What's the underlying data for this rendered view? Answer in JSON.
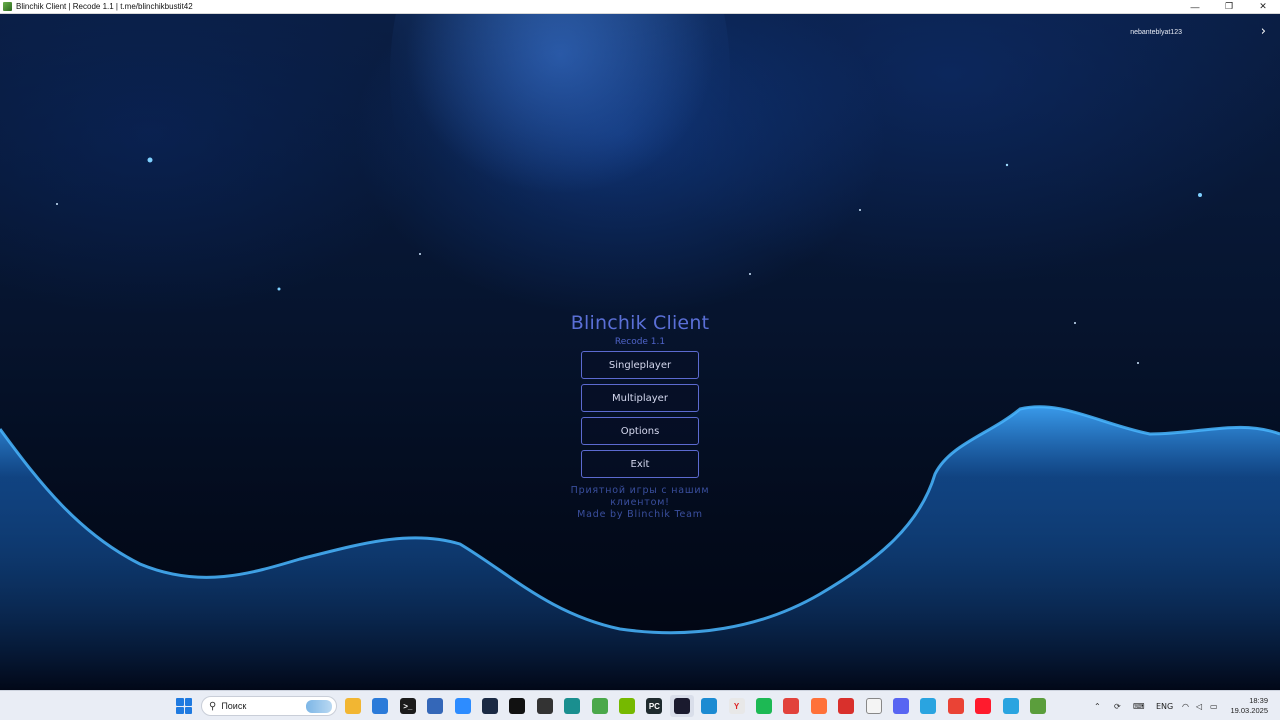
{
  "window": {
    "title": "Blinchik Client | Recode 1.1 | t.me/blinchikbustit42",
    "minimize": "—",
    "maximize": "❐",
    "close": "✕"
  },
  "profile": {
    "username": "nebanteblyat123",
    "arrow": "›"
  },
  "menu": {
    "title": "Blinchik Client",
    "subtitle": "Recode 1.1",
    "buttons": [
      "Singleplayer",
      "Multiplayer",
      "Options",
      "Exit"
    ],
    "note_line1": "Приятной игры с нашим клиентом!",
    "note_line2": "Made by Blinchik Team"
  },
  "colors": {
    "accent": "#5a6fd6",
    "button_border": "#5c6ad0",
    "note": "#3a4f9e"
  },
  "taskbar": {
    "search_icon": "search-icon",
    "search_placeholder": "Поиск",
    "apps": [
      {
        "name": "file-explorer-icon",
        "color": "#f2b632",
        "glyph": ""
      },
      {
        "name": "store-icon",
        "color": "#2b7bd9",
        "glyph": ""
      },
      {
        "name": "terminal-icon",
        "color": "#1b1b1b",
        "glyph": ">_"
      },
      {
        "name": "notepad-icon",
        "color": "#3467b8",
        "glyph": ""
      },
      {
        "name": "zoom-icon",
        "color": "#2d8cff",
        "glyph": ""
      },
      {
        "name": "steam-icon",
        "color": "#1b2a44",
        "glyph": ""
      },
      {
        "name": "capcut-icon",
        "color": "#111111",
        "glyph": ""
      },
      {
        "name": "nvidia-broadcast-icon",
        "color": "#333333",
        "glyph": ""
      },
      {
        "name": "media-app-icon",
        "color": "#1a8f8f",
        "glyph": ""
      },
      {
        "name": "play-app-icon",
        "color": "#4aa84a",
        "glyph": ""
      },
      {
        "name": "nvidia-icon",
        "color": "#76b900",
        "glyph": ""
      },
      {
        "name": "pycharm-icon",
        "color": "#1f2b2e",
        "glyph": "PC"
      },
      {
        "name": "intellij-icon",
        "color": "#1a1a2e",
        "glyph": ""
      },
      {
        "name": "edge-icon",
        "color": "#1c8bd2",
        "glyph": ""
      },
      {
        "name": "yandex-icon",
        "color": "#e8e8e8",
        "glyph": "Y"
      },
      {
        "name": "spotify-icon",
        "color": "#1db954",
        "glyph": ""
      },
      {
        "name": "anydesk-icon",
        "color": "#e2423b",
        "glyph": ""
      },
      {
        "name": "firefox-icon",
        "color": "#ff7139",
        "glyph": ""
      },
      {
        "name": "anydesk-red-icon",
        "color": "#d9302c",
        "glyph": ""
      },
      {
        "name": "github-icon",
        "color": "#f4f4f4",
        "glyph": ""
      },
      {
        "name": "discord-icon",
        "color": "#5865f2",
        "glyph": ""
      },
      {
        "name": "telegram-icon",
        "color": "#2aa4e0",
        "glyph": ""
      },
      {
        "name": "chrome-icon",
        "color": "#ea4335",
        "glyph": ""
      },
      {
        "name": "opera-icon",
        "color": "#ff1b2d",
        "glyph": ""
      },
      {
        "name": "telegram-2-icon",
        "color": "#2aa4e0",
        "glyph": ""
      },
      {
        "name": "minecraft-icon",
        "color": "#5b9e3c",
        "glyph": ""
      }
    ],
    "language": "ENG",
    "time": "18:39",
    "date": "19.03.2025"
  }
}
